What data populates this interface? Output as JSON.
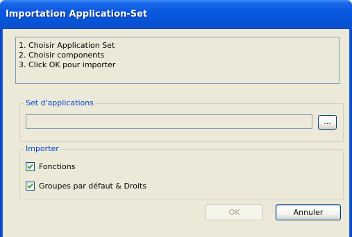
{
  "window": {
    "title": "Importation Application-Set"
  },
  "instructions": {
    "lines": [
      "1. Choisir Application Set",
      "2. Choisir components",
      "3. Click OK pour importer"
    ]
  },
  "set_group": {
    "legend": "Set d'applications",
    "path_value": "",
    "browse_label": "..."
  },
  "import_group": {
    "legend": "Importer",
    "options": [
      {
        "label": "Fonctions",
        "checked": true
      },
      {
        "label": "Groupes par défaut & Droits",
        "checked": true
      }
    ]
  },
  "buttons": {
    "ok_label": "OK",
    "ok_enabled": false,
    "cancel_label": "Annuler"
  },
  "colors": {
    "titlebar": "#0654d8",
    "dialog_bg": "#ece9d8",
    "group_legend": "#0046d5",
    "check_mark": "#21a121"
  }
}
